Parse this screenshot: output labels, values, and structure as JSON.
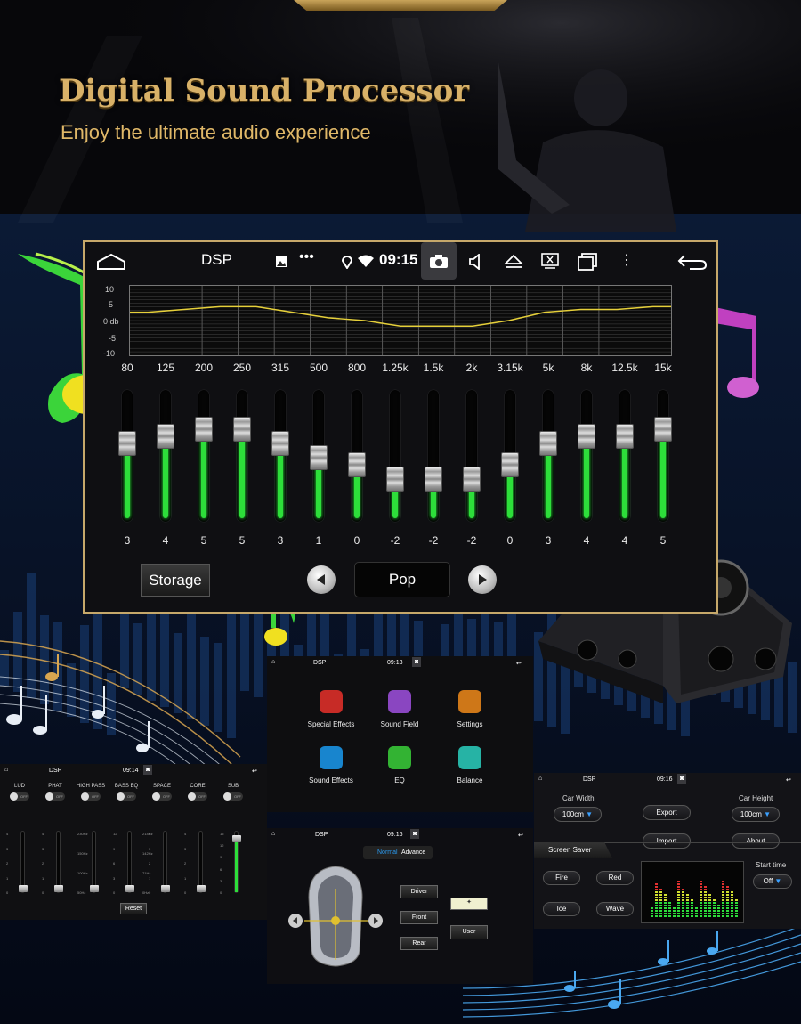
{
  "header": {
    "title": "Digital Sound Processor",
    "subtitle": "Enjoy the ultimate audio experience"
  },
  "main_screen": {
    "app_title": "DSP",
    "time": "09:15",
    "graph_y_labels": [
      "10",
      "5",
      "0 db",
      "-5",
      "-10"
    ],
    "bands": [
      {
        "freq": "80",
        "value": "3",
        "level": 3
      },
      {
        "freq": "125",
        "value": "4",
        "level": 4
      },
      {
        "freq": "200",
        "value": "5",
        "level": 5
      },
      {
        "freq": "250",
        "value": "5",
        "level": 5
      },
      {
        "freq": "315",
        "value": "3",
        "level": 3
      },
      {
        "freq": "500",
        "value": "1",
        "level": 1
      },
      {
        "freq": "800",
        "value": "0",
        "level": 0
      },
      {
        "freq": "1.25k",
        "value": "-2",
        "level": -2
      },
      {
        "freq": "1.5k",
        "value": "-2",
        "level": -2
      },
      {
        "freq": "2k",
        "value": "-2",
        "level": -2
      },
      {
        "freq": "3.15k",
        "value": "0",
        "level": 0
      },
      {
        "freq": "5k",
        "value": "3",
        "level": 3
      },
      {
        "freq": "8k",
        "value": "4",
        "level": 4
      },
      {
        "freq": "12.5k",
        "value": "4",
        "level": 4
      },
      {
        "freq": "15k",
        "value": "5",
        "level": 5
      }
    ],
    "storage_label": "Storage",
    "preset": "Pop",
    "accent_color": "#2dde3a",
    "curve_color": "#e6d03a",
    "frame_color": "#c6a86a"
  },
  "menu_screen": {
    "app_title": "DSP",
    "time": "09:13",
    "items": [
      {
        "label": "Special Effects",
        "icon": "music-note-icon",
        "color": "#e8302a"
      },
      {
        "label": "Sound Field",
        "icon": "sound-field-icon",
        "color": "#a050e0"
      },
      {
        "label": "Settings",
        "icon": "gear-icon",
        "color": "#f08a1a"
      },
      {
        "label": "Sound Effects",
        "icon": "headphones-icon",
        "color": "#1a9af0"
      },
      {
        "label": "EQ",
        "icon": "equalizer-icon",
        "color": "#3ad03a"
      },
      {
        "label": "Balance",
        "icon": "waveform-icon",
        "color": "#2ad0c0"
      }
    ]
  },
  "effects_screen": {
    "app_title": "DSP",
    "time": "09:14",
    "channels": [
      {
        "name": "LUD",
        "toggle": "OFF",
        "ticks": [
          "4",
          "3",
          "2",
          "1",
          "0"
        ]
      },
      {
        "name": "PHAT",
        "toggle": "OFF",
        "ticks": [
          "4",
          "3",
          "2",
          "1",
          "0"
        ]
      },
      {
        "name": "HIGH PASS",
        "toggle": "OFF",
        "ticks": [
          "230Hz",
          "150Hz",
          "100Hz",
          "50Hz"
        ]
      },
      {
        "name": "BASS EQ",
        "toggle": "OFF",
        "ticks": [
          "12",
          "9",
          "6",
          "3",
          "0"
        ]
      },
      {
        "name": "SPACE",
        "toggle": "OFF",
        "ticks": [
          "4",
          "3",
          "2",
          "1",
          "0"
        ]
      },
      {
        "name": "CORE",
        "toggle": "OFF",
        "ticks": [
          "4",
          "3",
          "2",
          "1",
          "0"
        ]
      },
      {
        "name": "SUB",
        "toggle": "OFF",
        "ticks": [
          "15",
          "12",
          "9",
          "6",
          "3",
          "0"
        ]
      }
    ],
    "bass_freq_ticks": [
      "214Hz",
      "142Hz",
      "71Hz",
      "0Hz"
    ],
    "reset_label": "Reset"
  },
  "settings_screen": {
    "app_title": "DSP",
    "time": "09:16",
    "car_width_label": "Car Width",
    "car_width_value": "100cm",
    "car_height_label": "Car Height",
    "car_height_value": "100cm",
    "export_label": "Export",
    "import_label": "Import",
    "about_label": "About",
    "screen_saver_label": "Screen Saver",
    "effects": [
      "Fire",
      "Red",
      "Ice",
      "Wave"
    ],
    "start_time_label": "Start time",
    "start_time_value": "Off"
  },
  "balance_screen": {
    "app_title": "DSP",
    "time": "09:16",
    "tabs": [
      "Normal",
      "Advance"
    ],
    "positions": [
      "Driver",
      "Front",
      "Rear"
    ],
    "user_label": "User"
  }
}
